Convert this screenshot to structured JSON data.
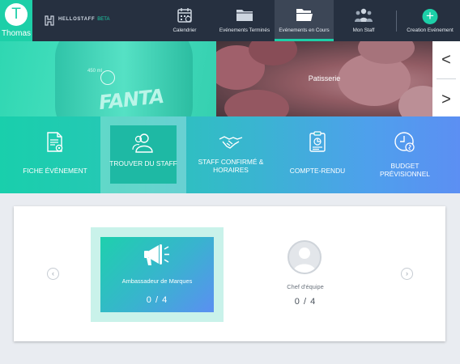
{
  "user": {
    "initial": "T",
    "name": "Thomas"
  },
  "logo": {
    "text": "HELLOSTAFF",
    "badge": "BETA"
  },
  "nav": {
    "items": [
      {
        "label": "Calendrier",
        "icon": "calendar-icon"
      },
      {
        "label": "Evénements Terminés",
        "icon": "folder-icon"
      },
      {
        "label": "Evénements en Cours",
        "icon": "open-folder-icon",
        "active": true
      },
      {
        "label": "Mon Staff",
        "icon": "staff-group-icon"
      },
      {
        "label": "Creation Evénement",
        "icon": "plus-icon"
      }
    ],
    "plus_symbol": "+"
  },
  "banner": {
    "left_caption_ml": "450 ml",
    "left_brand": "FANTA",
    "right_caption": "Patisserie",
    "prev_symbol": "<",
    "next_symbol": ">"
  },
  "tabs": [
    {
      "label": "FICHE ÉVÉNEMENT",
      "icon": "document-gear-icon"
    },
    {
      "label": "TROUVER DU STAFF",
      "icon": "users-icon",
      "active": true
    },
    {
      "label": "STAFF CONFIRMÉ & HORAIRES",
      "icon": "handshake-icon"
    },
    {
      "label": "COMPTE-RENDU",
      "icon": "report-icon"
    },
    {
      "label": "BUDGET PRÉVISIONNEL",
      "icon": "clock-budget-icon"
    }
  ],
  "roles": {
    "prev_symbol": "‹",
    "next_symbol": "›",
    "items": [
      {
        "name": "Ambassadeur de Marques",
        "count": "0 / 4",
        "icon": "megaphone-icon",
        "selected": true
      },
      {
        "name": "Chef d'équipe",
        "count": "0 / 4",
        "icon": "person-avatar-icon"
      }
    ]
  },
  "colors": {
    "nav_bg": "#263040",
    "accent": "#1dcfa8",
    "gradient_start": "#19cfac",
    "gradient_end": "#5c8ff3"
  }
}
